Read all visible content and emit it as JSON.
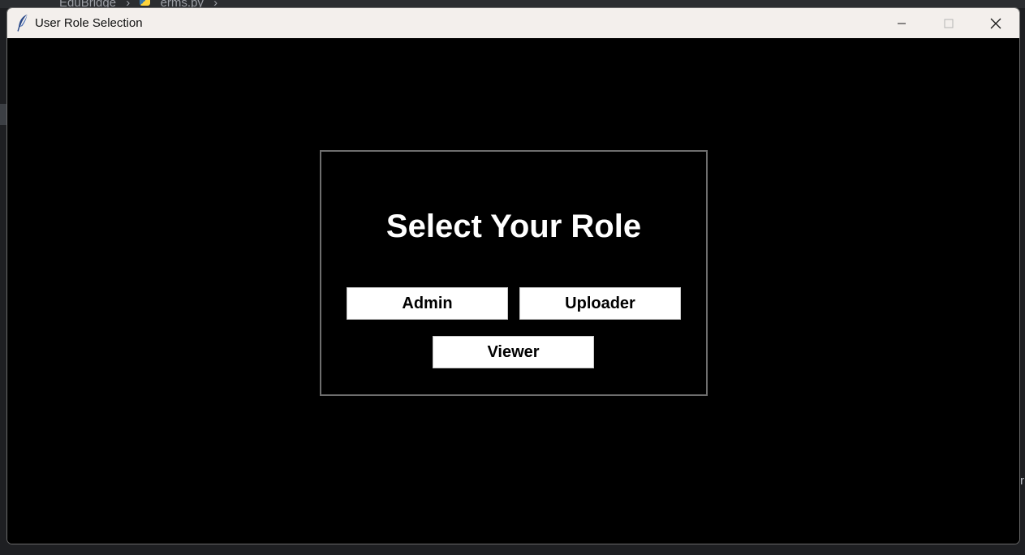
{
  "background": {
    "breadcrumb": [
      "EduBridge",
      "erms.py"
    ],
    "breadcrumb_separator": "›",
    "right_edge_char": "r"
  },
  "window": {
    "title": "User Role Selection",
    "app_icon": "feather-icon",
    "controls": {
      "minimize": "minimize-icon",
      "maximize": "maximize-icon",
      "close": "close-icon"
    }
  },
  "role_selection": {
    "heading": "Select Your Role",
    "buttons": {
      "admin": "Admin",
      "uploader": "Uploader",
      "viewer": "Viewer"
    }
  },
  "colors": {
    "titlebar": "#f3efec",
    "client_background": "#000000",
    "frame_border": "#6e6e6e",
    "button_background": "#ffffff",
    "heading_text": "#ffffff",
    "feather": "#2a4a8a"
  }
}
